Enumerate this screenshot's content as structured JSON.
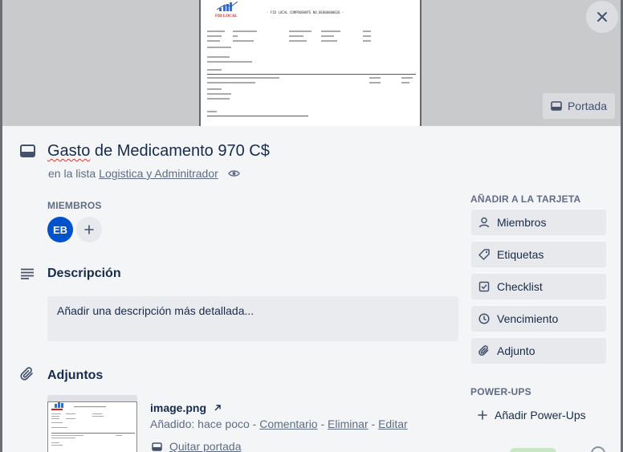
{
  "cover": {
    "doc_logo_text": "FID LOCAL",
    "doc_heading": "- FID LOCAL COMPROBANTE NO.0E000000026 -",
    "button_label": "Portada"
  },
  "card": {
    "title_underlined": "Gasto",
    "title_rest": " de Medicamento 970 C$",
    "in_list_prefix": "en la lista",
    "list_name": "Logistica y Adminitrador"
  },
  "members": {
    "label": "MIEMBROS",
    "avatar_initials": "EB",
    "avatar_color": "#0052cc"
  },
  "description": {
    "title": "Descripción",
    "placeholder": "Añadir una descripción más detallada..."
  },
  "attachments": {
    "title": "Adjuntos",
    "items": [
      {
        "name": "image.png",
        "added_prefix": "Añadido: hace poco - ",
        "comment_label": "Comentario",
        "delete_label": "Eliminar",
        "edit_label": "Editar",
        "remove_cover_label": "Quitar portada"
      }
    ]
  },
  "sidebar": {
    "add_to_card_label": "AÑADIR A LA TARJETA",
    "buttons": [
      {
        "label": "Miembros",
        "icon": "person-icon"
      },
      {
        "label": "Etiquetas",
        "icon": "tag-icon"
      },
      {
        "label": "Checklist",
        "icon": "checkbox-icon"
      },
      {
        "label": "Vencimiento",
        "icon": "clock-icon"
      },
      {
        "label": "Adjunto",
        "icon": "paperclip-icon"
      }
    ],
    "powerups_label": "POWER-UPS",
    "add_powerups_label": "Añadir Power-Ups"
  }
}
